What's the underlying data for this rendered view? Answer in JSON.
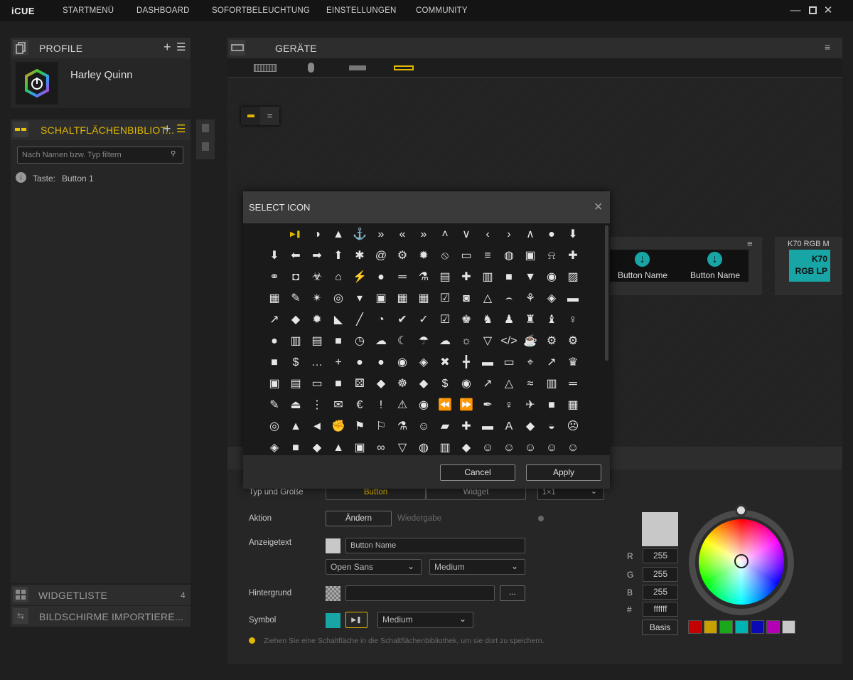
{
  "app": {
    "logo": "iCUE"
  },
  "nav": [
    "STARTMENÜ",
    "DASHBOARD",
    "SOFORTBELEUCHTUNG",
    "EINSTELLUNGEN",
    "COMMUNITY"
  ],
  "profile": {
    "title": "PROFILE",
    "name": "Harley Quinn"
  },
  "library": {
    "title": "SCHALTFLÄCHENBIBLIOT...",
    "search_placeholder": "Nach Namen bzw. Typ filtern",
    "item_prefix": "Taste:",
    "item_label": "Button 1"
  },
  "widgetlist": {
    "title": "WIDGETLISTE",
    "count": "4"
  },
  "import": {
    "title": "BILDSCHIRME IMPORTIERE..."
  },
  "devices": {
    "title": "GERÄTE"
  },
  "preview": {
    "button1": "Button Name",
    "button2": "Button Name",
    "k70_title": "K70 RGB M",
    "k70_label": "K70 RGB LP"
  },
  "modal": {
    "title": "SELECT ICON",
    "cancel": "Cancel",
    "apply": "Apply"
  },
  "icons": [
    [
      "play-pause",
      "half-circle",
      "tree",
      "anchor",
      "double-down",
      "double-left",
      "double-right",
      "double-up",
      "chevron-down",
      "chevron-left",
      "chevron-right",
      "chevron-up",
      "apple",
      "arrow-down-circle"
    ],
    [
      "arrow-down-circle",
      "arrow-left-circle",
      "arrow-right-circle",
      "arrow-up-circle",
      "asterisk",
      "at",
      "cog",
      "burst",
      "ban",
      "battery",
      "bars",
      "basketball",
      "beer",
      "bell",
      "book-plus"
    ],
    [
      "bicycle",
      "binoculars",
      "biohazard",
      "cake",
      "bolt",
      "bomb",
      "bone",
      "flask",
      "id-card",
      "medkit",
      "book-open",
      "book",
      "bookmark",
      "bowling",
      "box-open"
    ],
    [
      "briefcase",
      "brush",
      "bug",
      "target",
      "drop",
      "bus",
      "calculator",
      "calendar",
      "calendar-check",
      "camera",
      "tent",
      "candy-cane",
      "leaf",
      "controller",
      "car"
    ],
    [
      "carrot",
      "cat",
      "certificate",
      "chart-area",
      "chart-line",
      "chart-pie",
      "check-circle",
      "check",
      "check-square",
      "chess-king",
      "chess-knight",
      "chess-pawn",
      "chess-rook",
      "chess-bishop",
      "child"
    ],
    [
      "circle",
      "city",
      "clipboard-list",
      "clipboard",
      "clock",
      "cloud-download",
      "cloud-moon",
      "cloud-rain",
      "cloud",
      "cloud-sun",
      "cocktail",
      "code",
      "coffee",
      "gear",
      "gears"
    ],
    [
      "comment",
      "comment-dollar",
      "comment-dots",
      "comment-plus",
      "comment-round",
      "comments",
      "compact-disc",
      "compass",
      "compress",
      "compress-alt",
      "couch",
      "credit-card",
      "crosshairs",
      "crow",
      "crown"
    ],
    [
      "cube",
      "database",
      "desktop",
      "box",
      "dice",
      "directions",
      "dharma",
      "dog",
      "dollar",
      "dot-circle",
      "dove",
      "drafting",
      "dragon",
      "drum",
      "dumbbell"
    ],
    [
      "edit",
      "eject",
      "ellipsis",
      "envelope",
      "euro",
      "exclamation",
      "warning",
      "eye",
      "backward",
      "forward",
      "feather",
      "female",
      "plane",
      "file",
      "film"
    ],
    [
      "fingerprint",
      "fire",
      "fish",
      "fist",
      "flag",
      "flag-usa",
      "flask-vial",
      "flushed",
      "folder-open",
      "folder-plus",
      "folder",
      "font",
      "football",
      "frog",
      "frown"
    ],
    [
      "gamepad",
      "gas-pump",
      "gem",
      "ghost",
      "gift",
      "glasses",
      "glass",
      "globe",
      "road",
      "graduation-cap",
      "grimace",
      "grin",
      "grin-beam",
      "grin-tongue",
      "grin-wink"
    ]
  ],
  "editor": {
    "type_label": "Typ und Größe",
    "type_button": "Button",
    "type_widget": "Widget",
    "size": "1×1",
    "action_label": "Aktion",
    "action_button": "Ändern",
    "action_value": "Wiedergabe",
    "display_label": "Anzeigetext",
    "display_value": "Button Name",
    "font": "Open Sans",
    "weight": "Medium",
    "bg_label": "Hintergrund",
    "bg_button": "...",
    "symbol_label": "Symbol",
    "symbol_size": "Medium",
    "hint": "Ziehen Sie eine Schaltfläche in die Schaltflächenbibliothek, um sie dort zu speichern."
  },
  "color": {
    "r_label": "R",
    "g_label": "G",
    "b_label": "B",
    "hex_label": "#",
    "r": "255",
    "g": "255",
    "b": "255",
    "hex": "ffffff",
    "basis": "Basis",
    "swatches": [
      "#c40000",
      "#c8a000",
      "#1aa81a",
      "#00b4b4",
      "#0a0ab4",
      "#b400b4",
      "#c8c8c8"
    ]
  }
}
